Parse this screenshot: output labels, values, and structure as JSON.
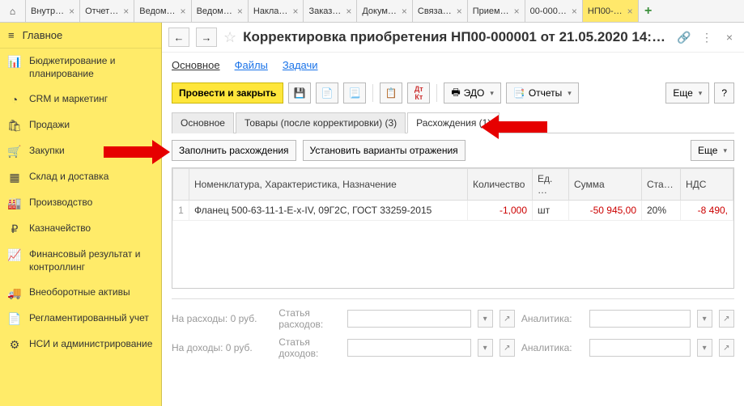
{
  "tabs": [
    "Внутр…",
    "Отчет…",
    "Ведом…",
    "Ведом…",
    "Накла…",
    "Заказ…",
    "Докум…",
    "Связа…",
    "Прием…",
    "00-000…",
    "НП00-…"
  ],
  "activeTab": 10,
  "sidebar": {
    "main_label": "Главное",
    "items": [
      {
        "icon": "chart-icon",
        "label": "Бюджетирование и планирование"
      },
      {
        "icon": "pie-icon",
        "label": "CRM и маркетинг"
      },
      {
        "icon": "bag-icon",
        "label": "Продажи"
      },
      {
        "icon": "cart-icon",
        "label": "Закупки"
      },
      {
        "icon": "boxes-icon",
        "label": "Склад и доставка"
      },
      {
        "icon": "factory-icon",
        "label": "Производство"
      },
      {
        "icon": "ruble-icon",
        "label": "Казначейство"
      },
      {
        "icon": "bars-icon",
        "label": "Финансовый результат и контроллинг"
      },
      {
        "icon": "truck-icon",
        "label": "Внеоборотные активы"
      },
      {
        "icon": "doc-icon",
        "label": "Регламентированный учет"
      },
      {
        "icon": "gear-icon",
        "label": "НСИ и администрирование"
      }
    ]
  },
  "doc": {
    "title": "Корректировка приобретения НП00-000001 от 21.05.2020 14:…"
  },
  "sections": {
    "main": "Основное",
    "files": "Файлы",
    "tasks": "Задачи"
  },
  "toolbar": {
    "post_close": "Провести и закрыть",
    "edo": "ЭДО",
    "reports": "Отчеты",
    "more": "Еще",
    "help": "?"
  },
  "inner_tabs": {
    "main": "Основное",
    "goods": "Товары (после корректировки) (3)",
    "diff": "Расхождения (1)"
  },
  "subtoolbar": {
    "fill": "Заполнить расхождения",
    "variants": "Установить варианты отражения",
    "more": "Еще"
  },
  "table": {
    "cols": {
      "nom": "Номенклатура, Характеристика, Назначение",
      "qty": "Количество",
      "unit": "Ед. …",
      "sum": "Сумма",
      "rate": "Ста…",
      "vat": "НДС"
    },
    "rows": [
      {
        "n": "1",
        "nom": "Фланец 500-63-11-1-E-x-IV, 09Г2С, ГОСТ 33259-2015",
        "qty": "-1,000",
        "unit": "шт",
        "sum": "-50 945,00",
        "rate": "20%",
        "vat": "-8 490,"
      }
    ]
  },
  "footer": {
    "expense_label": "На расходы: 0 руб.",
    "income_label": "На доходы: 0 руб.",
    "article_exp": "Статья расходов:",
    "article_inc": "Статья доходов:",
    "analytics": "Аналитика:"
  }
}
